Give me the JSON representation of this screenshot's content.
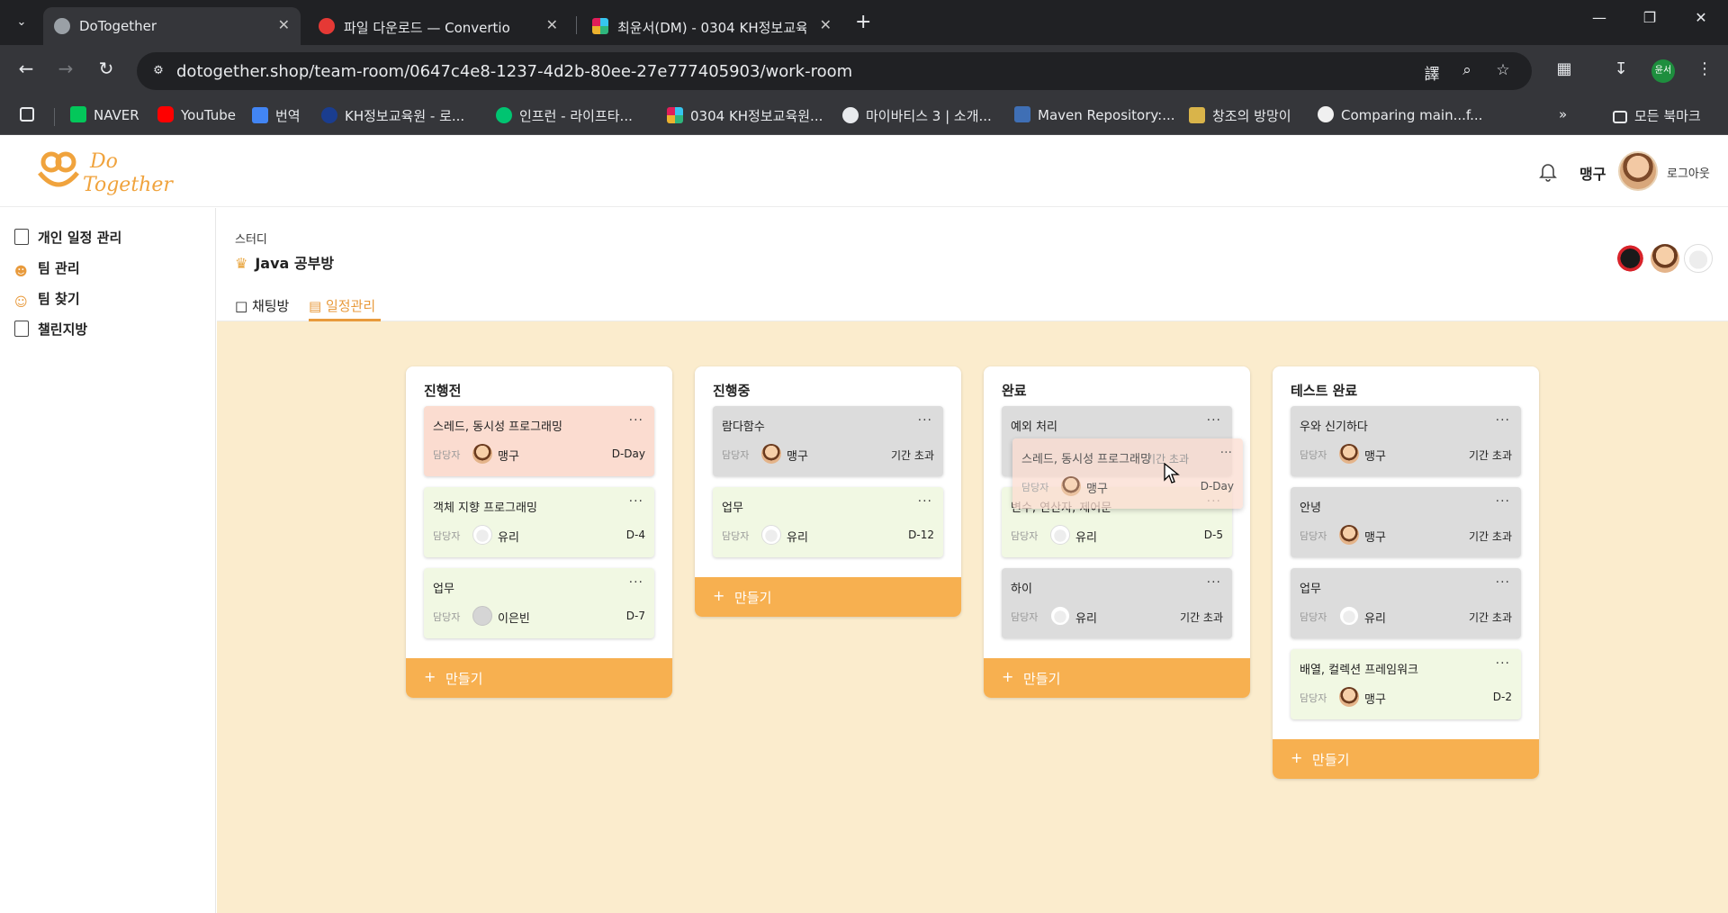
{
  "browser": {
    "tabs": [
      {
        "title": "DoTogether",
        "favicon": "globe-icon",
        "active": true
      },
      {
        "title": "파일 다운로드 — Convertio",
        "favicon": "convertio-icon"
      },
      {
        "title": "최윤서(DM) - 0304 KH정보교육",
        "favicon": "slack-icon"
      }
    ],
    "url": "dotogether.shop/team-room/0647c4e8-1237-4d2b-80ee-27e777405903/work-room",
    "profile_initials": "윤서",
    "bookmarks": [
      "NAVER",
      "YouTube",
      "번역",
      "KH정보교육원 - 로...",
      "인프런 - 라이프타...",
      "0304 KH정보교육원...",
      "마이바티스 3 | 소개...",
      "Maven Repository:...",
      "창조의 방망이",
      "Comparing main...f..."
    ],
    "all_bookmarks": "모든 북마크"
  },
  "header": {
    "logo_text": "Do Together",
    "user_name": "맹구",
    "logout": "로그아웃"
  },
  "sidebar": {
    "items": [
      {
        "label": "개인 일정 관리",
        "icon": "page-icon"
      },
      {
        "label": "팀 관리",
        "icon": "team-icon"
      },
      {
        "label": "팀 찾기",
        "icon": "find-team-icon"
      },
      {
        "label": "챌린지방",
        "icon": "page-icon"
      }
    ]
  },
  "room": {
    "category": "스터디",
    "title": "Java 공부방",
    "tabs": [
      {
        "label": "채팅방",
        "icon": "chat-icon",
        "active": false
      },
      {
        "label": "일정관리",
        "icon": "clipboard-icon",
        "active": true
      }
    ]
  },
  "board": {
    "owner_label": "담당자",
    "add_label": "만들기",
    "columns": [
      {
        "title": "진행전",
        "cards": [
          {
            "title": "스레드, 동시성 프로그래밍",
            "owner": "맹구",
            "due": "D-Day",
            "color": "red"
          },
          {
            "title": "객체 지향 프로그래밍",
            "owner": "유리",
            "due": "D-4",
            "color": "green"
          },
          {
            "title": "업무",
            "owner": "이은빈",
            "due": "D-7",
            "color": "green"
          }
        ]
      },
      {
        "title": "진행중",
        "cards": [
          {
            "title": "람다함수",
            "owner": "맹구",
            "due": "기간 초과",
            "color": "gray"
          },
          {
            "title": "업무",
            "owner": "유리",
            "due": "D-12",
            "color": "green"
          }
        ]
      },
      {
        "title": "완료",
        "cards": [
          {
            "title": "예외 처리",
            "owner": "",
            "due": "",
            "color": "gray"
          },
          {
            "title": "변수, 연산자, 제어문",
            "owner": "유리",
            "due": "D-5",
            "color": "green"
          },
          {
            "title": "하이",
            "owner": "유리",
            "due": "기간 초과",
            "color": "gray"
          }
        ]
      },
      {
        "title": "테스트 완료",
        "cards": [
          {
            "title": "우와 신기하다",
            "owner": "맹구",
            "due": "기간 초과",
            "color": "gray"
          },
          {
            "title": "안녕",
            "owner": "맹구",
            "due": "기간 초과",
            "color": "gray"
          },
          {
            "title": "업무",
            "owner": "유리",
            "due": "기간 초과",
            "color": "gray"
          },
          {
            "title": "배열, 컬렉션 프레임워크",
            "owner": "맹구",
            "due": "D-2",
            "color": "green"
          }
        ]
      }
    ],
    "dragging": {
      "title": "스레드, 동시성 프로그래밍",
      "owner": "맹구",
      "due": "D-Day",
      "under_text": "기간 초과"
    }
  },
  "colors": {
    "accent": "#e89a3c",
    "add_button": "#f7b050",
    "board_bg": "#fbeccd",
    "card_red": "#fbdcd0",
    "card_green": "#f1f8e3",
    "card_gray": "#dcdcdc"
  }
}
